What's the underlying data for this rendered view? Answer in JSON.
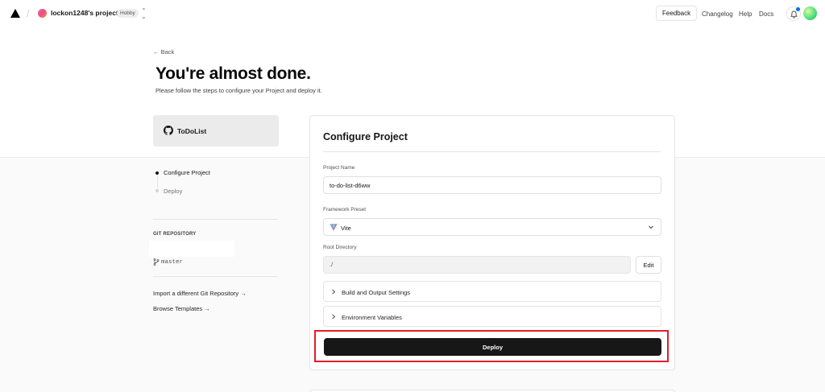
{
  "header": {
    "team_name": "lockon1248's projects",
    "plan_badge": "Hobby",
    "feedback_label": "Feedback",
    "nav": [
      "Changelog",
      "Help",
      "Docs"
    ]
  },
  "hero": {
    "back_label": "← Back",
    "title": "You're almost done.",
    "subtitle": "Please follow the steps to configure your Project and deploy it."
  },
  "repo_card": {
    "name": "ToDoList",
    "icon": "github-icon"
  },
  "steps": [
    {
      "label": "Configure Project",
      "active": true
    },
    {
      "label": "Deploy",
      "active": false
    }
  ],
  "git": {
    "section_label": "GIT REPOSITORY",
    "branch": "master"
  },
  "sidebar_links": {
    "import_other": "Import a different Git Repository →",
    "browse_templates": "Browse Templates →"
  },
  "configure": {
    "title": "Configure Project",
    "project_name_label": "Project Name",
    "project_name_value": "to-do-list-d6ww",
    "framework_label": "Framework Preset",
    "framework_value": "Vite",
    "root_label": "Root Directory",
    "root_value": "./",
    "edit_label": "Edit",
    "build_settings_label": "Build and Output Settings",
    "env_vars_label": "Environment Variables",
    "deploy_label": "Deploy"
  },
  "colors": {
    "accent_dark": "#171717",
    "highlight_red": "#e11d2a",
    "notification_blue": "#0070f3"
  }
}
